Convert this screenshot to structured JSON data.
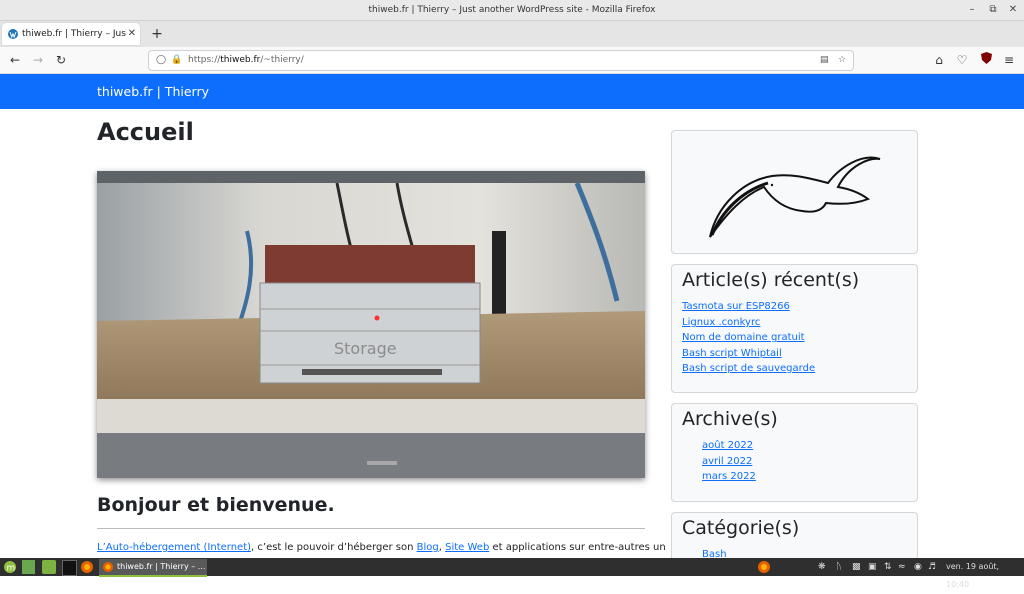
{
  "window": {
    "title": "thiweb.fr | Thierry – Just another WordPress site - Mozilla Firefox"
  },
  "tab": {
    "label": "thiweb.fr | Thierry – Just another WordPress site"
  },
  "url": {
    "prefix": "https://",
    "host": "thiweb.fr",
    "path": "/~thierry/"
  },
  "site": {
    "brand": "thiweb.fr | Thierry"
  },
  "page": {
    "title": "Accueil",
    "photo_text": "Storage",
    "heading": "Bonjour et bienvenue.",
    "intro": {
      "link1": "L’Auto-hébergement (Internet)",
      "text1": ", c’est le pouvoir d’héberger son ",
      "link2": "Blog",
      "text2": ", ",
      "link3": "Site Web",
      "text3": " et applications sur entre-autres un"
    }
  },
  "sidebar": {
    "recent": {
      "title": "Article(s) récent(s)",
      "items": [
        "Tasmota sur ESP8266",
        "Lignux .conkyrc",
        "Nom de domaine gratuit",
        "Bash script Whiptail",
        "Bash script de sauvegarde"
      ]
    },
    "archives": {
      "title": "Archive(s)",
      "items": [
        "août 2022",
        "avril 2022",
        "mars 2022"
      ]
    },
    "categories": {
      "title": "Catégorie(s)",
      "items": [
        "Bash"
      ]
    }
  },
  "taskbar": {
    "window_label": "thiweb.fr | Thierry – ...",
    "clock": "ven. 19 août, 10:40"
  },
  "colors": {
    "accent": "#0d6efd"
  },
  "icons": [
    "menu-icon",
    "show-desktop-icon",
    "files-icon",
    "terminal-icon",
    "firefox-icon",
    "shield-icon",
    "lock-icon",
    "reader-icon",
    "star-icon",
    "home-icon",
    "pocket-icon",
    "ublock-icon",
    "hamburger-icon"
  ]
}
